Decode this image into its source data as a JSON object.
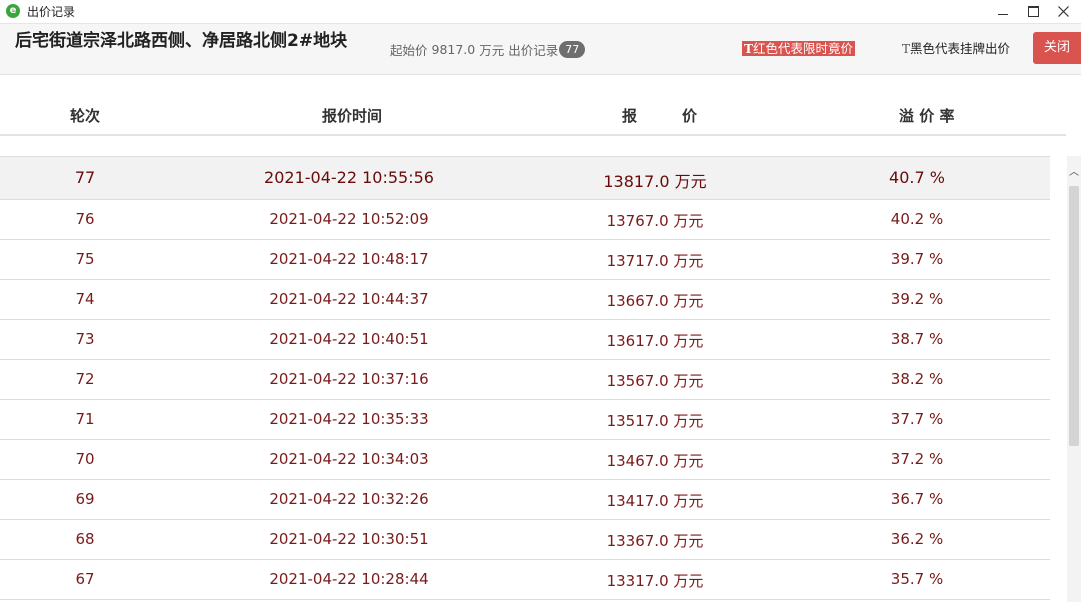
{
  "window": {
    "title": "出价记录",
    "app_icon": "e-icon",
    "controls": [
      "minimize",
      "maximize",
      "close"
    ]
  },
  "header": {
    "title": "后宅街道宗泽北路西侧、净居路北侧2#地块",
    "start_price_label": "起始价",
    "start_price_value": "9817.0",
    "start_price_unit": "万元",
    "records_label": "出价记录",
    "records_count": "77",
    "legend_red_mark": "T",
    "legend_red_text": "红色代表限时竟价",
    "legend_black_mark": "T",
    "legend_black_text": "黑色代表挂牌出价",
    "close_label": "关闭",
    "accent_color": "#d9534f"
  },
  "columns": {
    "round": "轮次",
    "time": "报价时间",
    "price": "报　　　价",
    "rate": "溢 价 率"
  },
  "rows": [
    {
      "round": "77",
      "time": "2021-04-22 10:55:56",
      "price": "13817.0 万元",
      "rate": "40.7 %"
    },
    {
      "round": "76",
      "time": "2021-04-22 10:52:09",
      "price": "13767.0 万元",
      "rate": "40.2 %"
    },
    {
      "round": "75",
      "time": "2021-04-22 10:48:17",
      "price": "13717.0 万元",
      "rate": "39.7 %"
    },
    {
      "round": "74",
      "time": "2021-04-22 10:44:37",
      "price": "13667.0 万元",
      "rate": "39.2 %"
    },
    {
      "round": "73",
      "time": "2021-04-22 10:40:51",
      "price": "13617.0 万元",
      "rate": "38.7 %"
    },
    {
      "round": "72",
      "time": "2021-04-22 10:37:16",
      "price": "13567.0 万元",
      "rate": "38.2 %"
    },
    {
      "round": "71",
      "time": "2021-04-22 10:35:33",
      "price": "13517.0 万元",
      "rate": "37.7 %"
    },
    {
      "round": "70",
      "time": "2021-04-22 10:34:03",
      "price": "13467.0 万元",
      "rate": "37.2 %"
    },
    {
      "round": "69",
      "time": "2021-04-22 10:32:26",
      "price": "13417.0 万元",
      "rate": "36.7 %"
    },
    {
      "round": "68",
      "time": "2021-04-22 10:30:51",
      "price": "13367.0 万元",
      "rate": "36.2 %"
    },
    {
      "round": "67",
      "time": "2021-04-22 10:28:44",
      "price": "13317.0 万元",
      "rate": "35.7 %"
    }
  ]
}
